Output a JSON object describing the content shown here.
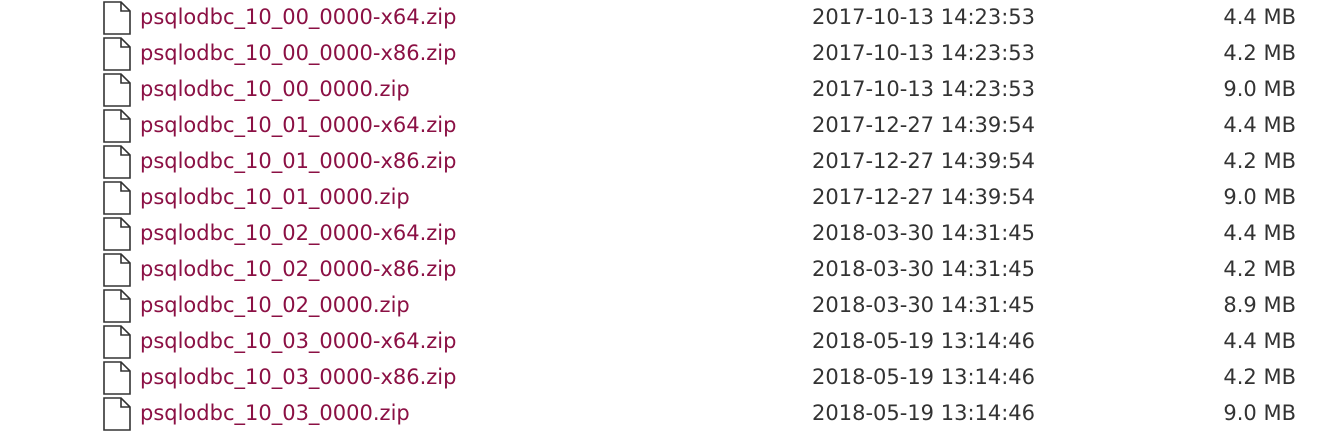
{
  "listing": {
    "colors": {
      "link": "#8b1044",
      "text": "#333333"
    },
    "file_icon": "file-icon",
    "rows": [
      {
        "name": "psqlodbc_10_00_0000-x64.zip",
        "modified": "2017-10-13 14:23:53",
        "size": "4.4 MB"
      },
      {
        "name": "psqlodbc_10_00_0000-x86.zip",
        "modified": "2017-10-13 14:23:53",
        "size": "4.2 MB"
      },
      {
        "name": "psqlodbc_10_00_0000.zip",
        "modified": "2017-10-13 14:23:53",
        "size": "9.0 MB"
      },
      {
        "name": "psqlodbc_10_01_0000-x64.zip",
        "modified": "2017-12-27 14:39:54",
        "size": "4.4 MB"
      },
      {
        "name": "psqlodbc_10_01_0000-x86.zip",
        "modified": "2017-12-27 14:39:54",
        "size": "4.2 MB"
      },
      {
        "name": "psqlodbc_10_01_0000.zip",
        "modified": "2017-12-27 14:39:54",
        "size": "9.0 MB"
      },
      {
        "name": "psqlodbc_10_02_0000-x64.zip",
        "modified": "2018-03-30 14:31:45",
        "size": "4.4 MB"
      },
      {
        "name": "psqlodbc_10_02_0000-x86.zip",
        "modified": "2018-03-30 14:31:45",
        "size": "4.2 MB"
      },
      {
        "name": "psqlodbc_10_02_0000.zip",
        "modified": "2018-03-30 14:31:45",
        "size": "8.9 MB"
      },
      {
        "name": "psqlodbc_10_03_0000-x64.zip",
        "modified": "2018-05-19 13:14:46",
        "size": "4.4 MB"
      },
      {
        "name": "psqlodbc_10_03_0000-x86.zip",
        "modified": "2018-05-19 13:14:46",
        "size": "4.2 MB"
      },
      {
        "name": "psqlodbc_10_03_0000.zip",
        "modified": "2018-05-19 13:14:46",
        "size": "9.0 MB"
      }
    ]
  }
}
